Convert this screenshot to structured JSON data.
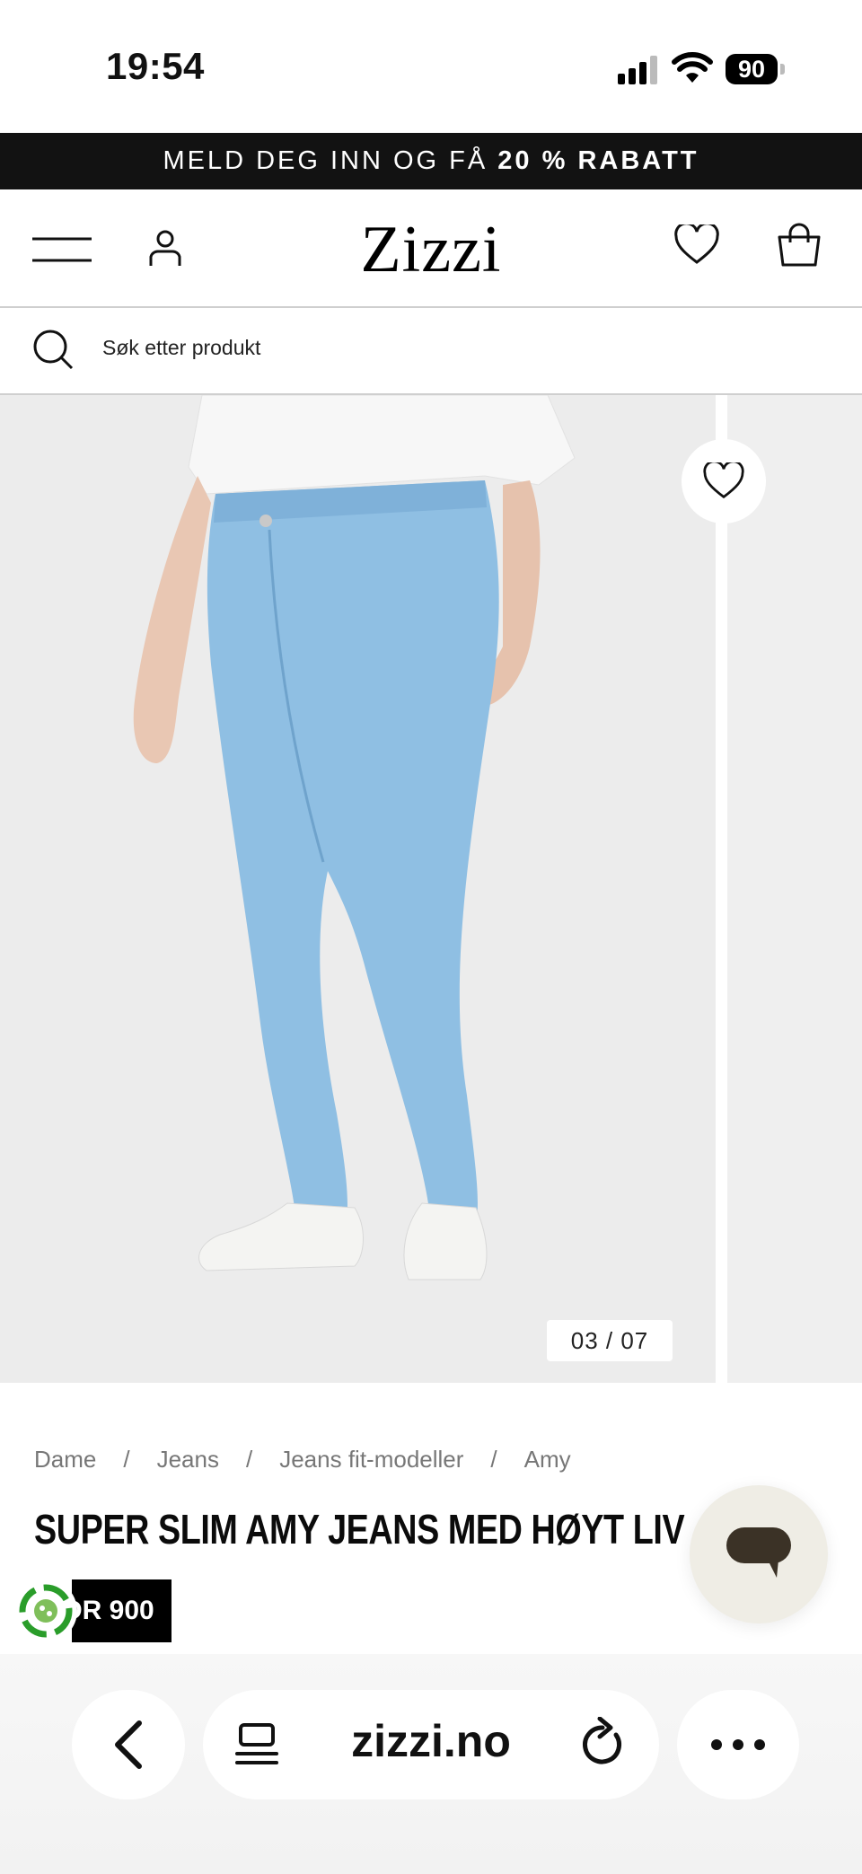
{
  "status_bar": {
    "time": "19:54",
    "battery": "90"
  },
  "promo": {
    "text_main": "MELD DEG INN OG FÅ ",
    "text_strong": "20 % RABATT"
  },
  "header": {
    "logo": "Zizzi"
  },
  "search": {
    "placeholder": "Søk etter produkt"
  },
  "gallery": {
    "counter": "03  /  07"
  },
  "breadcrumb": [
    "Dame",
    "Jeans",
    "Jeans fit-modeller",
    "Amy"
  ],
  "breadcrumb_separator": "/",
  "product": {
    "title": "SUPER SLIM AMY JEANS MED HØYT LIV",
    "price_visible": "DR 900"
  },
  "browser": {
    "url": "zizzi.no"
  },
  "icons": {
    "menu": "menu-icon",
    "account": "user-icon",
    "wishlist": "heart-icon",
    "bag": "shopping-bag-icon",
    "search": "search-icon",
    "favorite": "heart-icon",
    "chat": "chat-bubble-icon",
    "eco": "eco-badge-icon",
    "back": "chevron-left-icon",
    "tabs": "tabs-icon",
    "reload": "reload-icon",
    "more": "more-dots-icon"
  },
  "colors": {
    "banner_bg": "#121212",
    "chat_bg": "#efede5",
    "jeans": "#8fbfe3"
  }
}
